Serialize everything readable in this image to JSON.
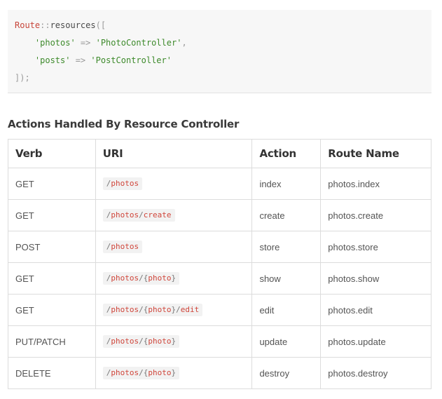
{
  "code": {
    "lines": [
      [
        {
          "t": "Route",
          "k": "class"
        },
        {
          "t": "::",
          "k": "punct"
        },
        {
          "t": "resources",
          "k": "plain"
        },
        {
          "t": "([",
          "k": "punct"
        }
      ],
      [
        {
          "t": "    ",
          "k": "plain"
        },
        {
          "t": "'photos'",
          "k": "str"
        },
        {
          "t": " => ",
          "k": "punct"
        },
        {
          "t": "'PhotoController'",
          "k": "str"
        },
        {
          "t": ",",
          "k": "punct"
        }
      ],
      [
        {
          "t": "    ",
          "k": "plain"
        },
        {
          "t": "'posts'",
          "k": "str"
        },
        {
          "t": " => ",
          "k": "punct"
        },
        {
          "t": "'PostController'",
          "k": "str"
        }
      ],
      [
        {
          "t": "]);",
          "k": "punct"
        }
      ]
    ]
  },
  "section": {
    "title": "Actions Handled By Resource Controller"
  },
  "table": {
    "headers": [
      "Verb",
      "URI",
      "Action",
      "Route Name"
    ],
    "rows": [
      {
        "verb": "GET",
        "uri": "/photos",
        "action": "index",
        "route": "photos.index"
      },
      {
        "verb": "GET",
        "uri": "/photos/create",
        "action": "create",
        "route": "photos.create"
      },
      {
        "verb": "POST",
        "uri": "/photos",
        "action": "store",
        "route": "photos.store"
      },
      {
        "verb": "GET",
        "uri": "/photos/{photo}",
        "action": "show",
        "route": "photos.show"
      },
      {
        "verb": "GET",
        "uri": "/photos/{photo}/edit",
        "action": "edit",
        "route": "photos.edit"
      },
      {
        "verb": "PUT/PATCH",
        "uri": "/photos/{photo}",
        "action": "update",
        "route": "photos.update"
      },
      {
        "verb": "DELETE",
        "uri": "/photos/{photo}",
        "action": "destroy",
        "route": "photos.destroy"
      }
    ]
  }
}
